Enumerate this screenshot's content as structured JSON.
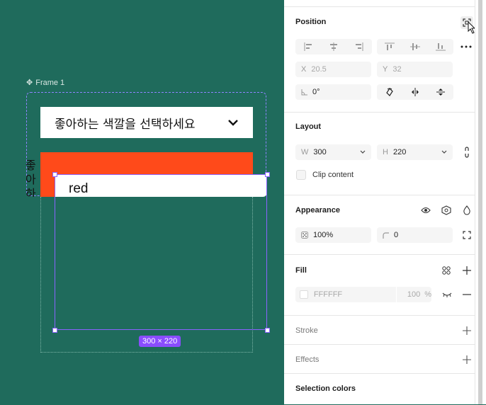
{
  "canvas": {
    "frame_label": "Frame 1",
    "dropdown_text": "좋아하는 색깔을 선택하세요",
    "vertical_text": "좋아하는",
    "option_text": "red",
    "size_badge": "300 × 220"
  },
  "panel": {
    "position": {
      "title": "Position",
      "x_label": "X",
      "x_value": "20.5",
      "y_label": "Y",
      "y_value": "32",
      "rotation": "0°"
    },
    "layout": {
      "title": "Layout",
      "w_label": "W",
      "w_value": "300",
      "h_label": "H",
      "h_value": "220",
      "clip_label": "Clip content"
    },
    "appearance": {
      "title": "Appearance",
      "opacity": "100%",
      "radius": "0"
    },
    "fill": {
      "title": "Fill",
      "hex": "FFFFFF",
      "opacity": "100",
      "unit": "%"
    },
    "stroke": {
      "title": "Stroke"
    },
    "effects": {
      "title": "Effects"
    },
    "selection_colors": {
      "title": "Selection colors"
    }
  },
  "colors": {
    "canvas_bg": "#1f6b5c",
    "selection": "#8a63ff",
    "red_block": "#ff4a1a",
    "badge": "#8a4dff"
  }
}
